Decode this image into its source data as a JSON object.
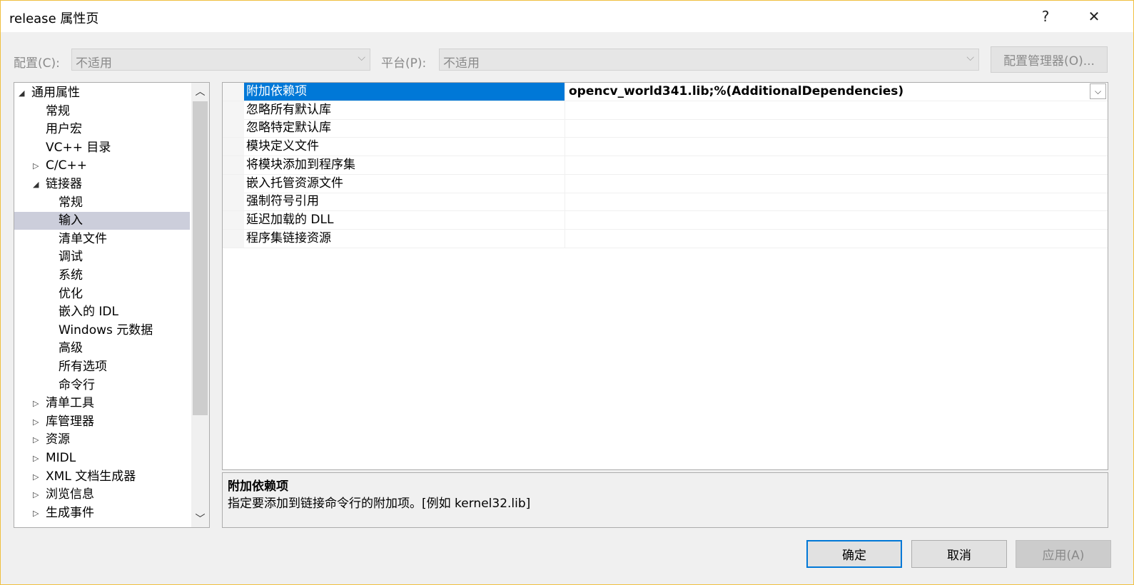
{
  "window": {
    "title": "release 属性页",
    "help_glyph": "?",
    "close_glyph": "✕"
  },
  "config_bar": {
    "config_label": "配置(C):",
    "config_value": "不适用",
    "platform_label": "平台(P):",
    "platform_value": "不适用",
    "manager_button": "配置管理器(O)..."
  },
  "tree": {
    "items": [
      {
        "label": "通用属性",
        "expander": "◢"
      },
      {
        "label": "常规"
      },
      {
        "label": "用户宏"
      },
      {
        "label": "VC++ 目录"
      },
      {
        "label": "C/C++",
        "expander": "▷"
      },
      {
        "label": "链接器",
        "expander": "◢"
      },
      {
        "label": "常规"
      },
      {
        "label": "输入",
        "selected": true
      },
      {
        "label": "清单文件"
      },
      {
        "label": "调试"
      },
      {
        "label": "系统"
      },
      {
        "label": "优化"
      },
      {
        "label": "嵌入的 IDL"
      },
      {
        "label": "Windows 元数据"
      },
      {
        "label": "高级"
      },
      {
        "label": "所有选项"
      },
      {
        "label": "命令行"
      },
      {
        "label": "清单工具",
        "expander": "▷"
      },
      {
        "label": "库管理器",
        "expander": "▷"
      },
      {
        "label": "资源",
        "expander": "▷"
      },
      {
        "label": "MIDL",
        "expander": "▷"
      },
      {
        "label": "XML 文档生成器",
        "expander": "▷"
      },
      {
        "label": "浏览信息",
        "expander": "▷"
      },
      {
        "label": "生成事件",
        "expander": "▷"
      }
    ]
  },
  "properties": {
    "rows": [
      {
        "name": "附加依赖项",
        "value": "opencv_world341.lib;%(AdditionalDependencies)",
        "selected": true
      },
      {
        "name": "忽略所有默认库",
        "value": ""
      },
      {
        "name": "忽略特定默认库",
        "value": ""
      },
      {
        "name": "模块定义文件",
        "value": ""
      },
      {
        "name": "将模块添加到程序集",
        "value": ""
      },
      {
        "name": "嵌入托管资源文件",
        "value": ""
      },
      {
        "name": "强制符号引用",
        "value": ""
      },
      {
        "name": "延迟加载的 DLL",
        "value": ""
      },
      {
        "name": "程序集链接资源",
        "value": ""
      }
    ]
  },
  "description": {
    "title": "附加依赖项",
    "text": "指定要添加到链接命令行的附加项。[例如 kernel32.lib]"
  },
  "buttons": {
    "ok": "确定",
    "cancel": "取消",
    "apply": "应用(A)"
  },
  "colors": {
    "selection_blue": "#0078d7",
    "tree_selection": "#cccedb"
  }
}
